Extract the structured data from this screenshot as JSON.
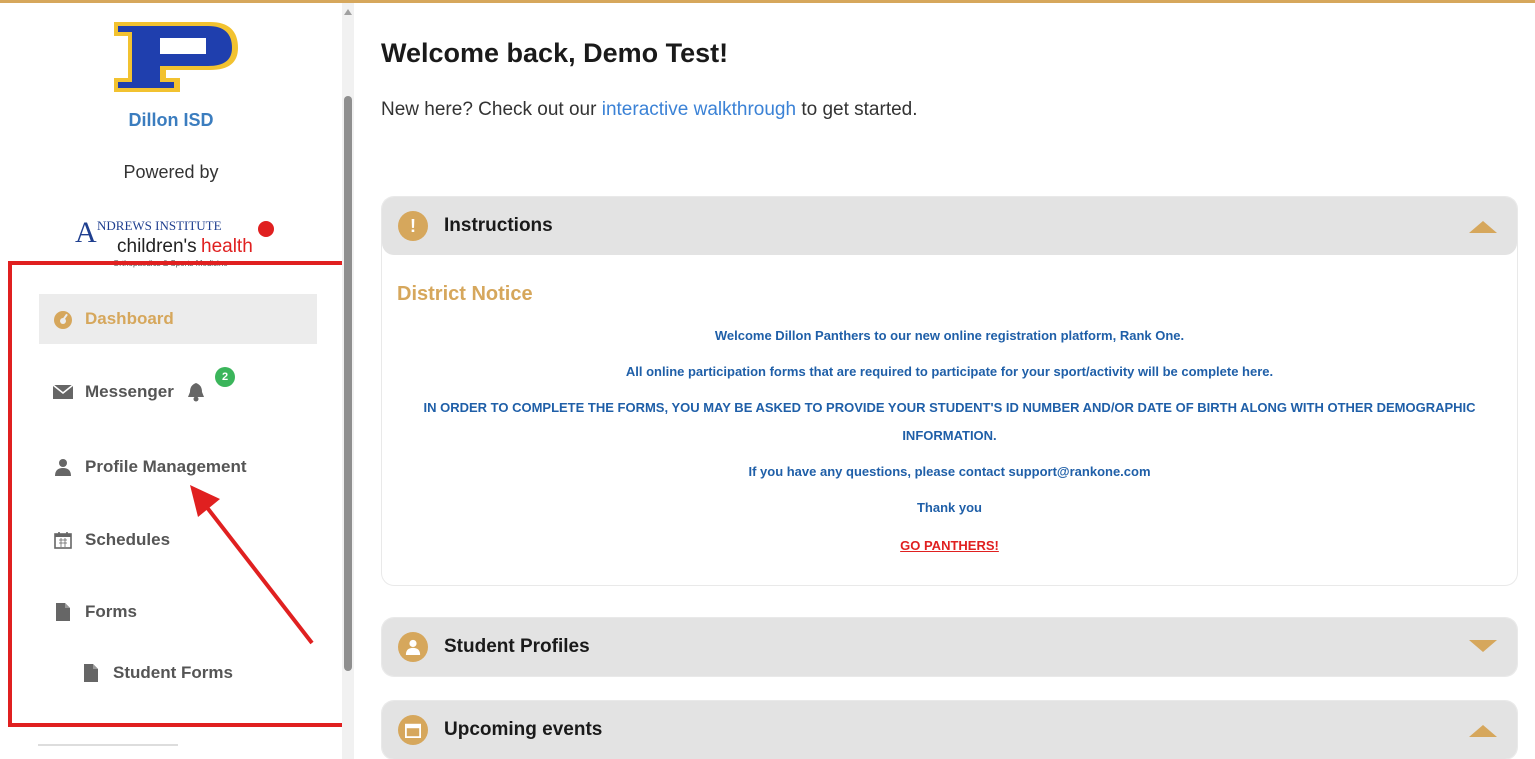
{
  "sidebar": {
    "district_name": "Dillon ISD",
    "powered_by": "Powered by",
    "partner": {
      "line1": "ANDREWS INSTITUTE",
      "line2": "children'shealth",
      "line3": "Orthopaedics & Sports Medicine"
    },
    "nav": [
      {
        "label": "Dashboard",
        "icon": "dashboard-icon",
        "active": true
      },
      {
        "label": "Messenger",
        "icon": "envelope-icon",
        "badge": "2"
      },
      {
        "label": "Profile Management",
        "icon": "user-icon"
      },
      {
        "label": "Schedules",
        "icon": "calendar-icon"
      },
      {
        "label": "Forms",
        "icon": "file-icon"
      },
      {
        "label": "Student Forms",
        "icon": "file-icon"
      }
    ]
  },
  "main": {
    "title": "Welcome back, Demo Test!",
    "intro_prefix": "New here? Check out our ",
    "intro_link": "interactive walkthrough",
    "intro_suffix": " to get started.",
    "panels": {
      "instructions": {
        "title": "Instructions",
        "notice_title": "District Notice",
        "lines": [
          "Welcome Dillon Panthers to our new online registration platform, Rank One.",
          "All online participation forms that are required to participate for your sport/activity will be complete here.",
          "IN ORDER TO COMPLETE THE FORMS, YOU MAY BE ASKED TO PROVIDE YOUR STUDENT'S ID NUMBER AND/OR DATE OF BIRTH ALONG WITH OTHER DEMOGRAPHIC",
          "INFORMATION.",
          "If you have any questions, please contact support@rankone.com",
          "Thank you",
          "GO PANTHERS!"
        ]
      },
      "student_profiles": {
        "title": "Student Profiles"
      },
      "upcoming_events": {
        "title": "Upcoming events"
      }
    }
  },
  "colors": {
    "accent": "#d6a75c",
    "link": "#3b82d6",
    "highlight_box": "#e02020",
    "badge": "#3bb55b"
  }
}
